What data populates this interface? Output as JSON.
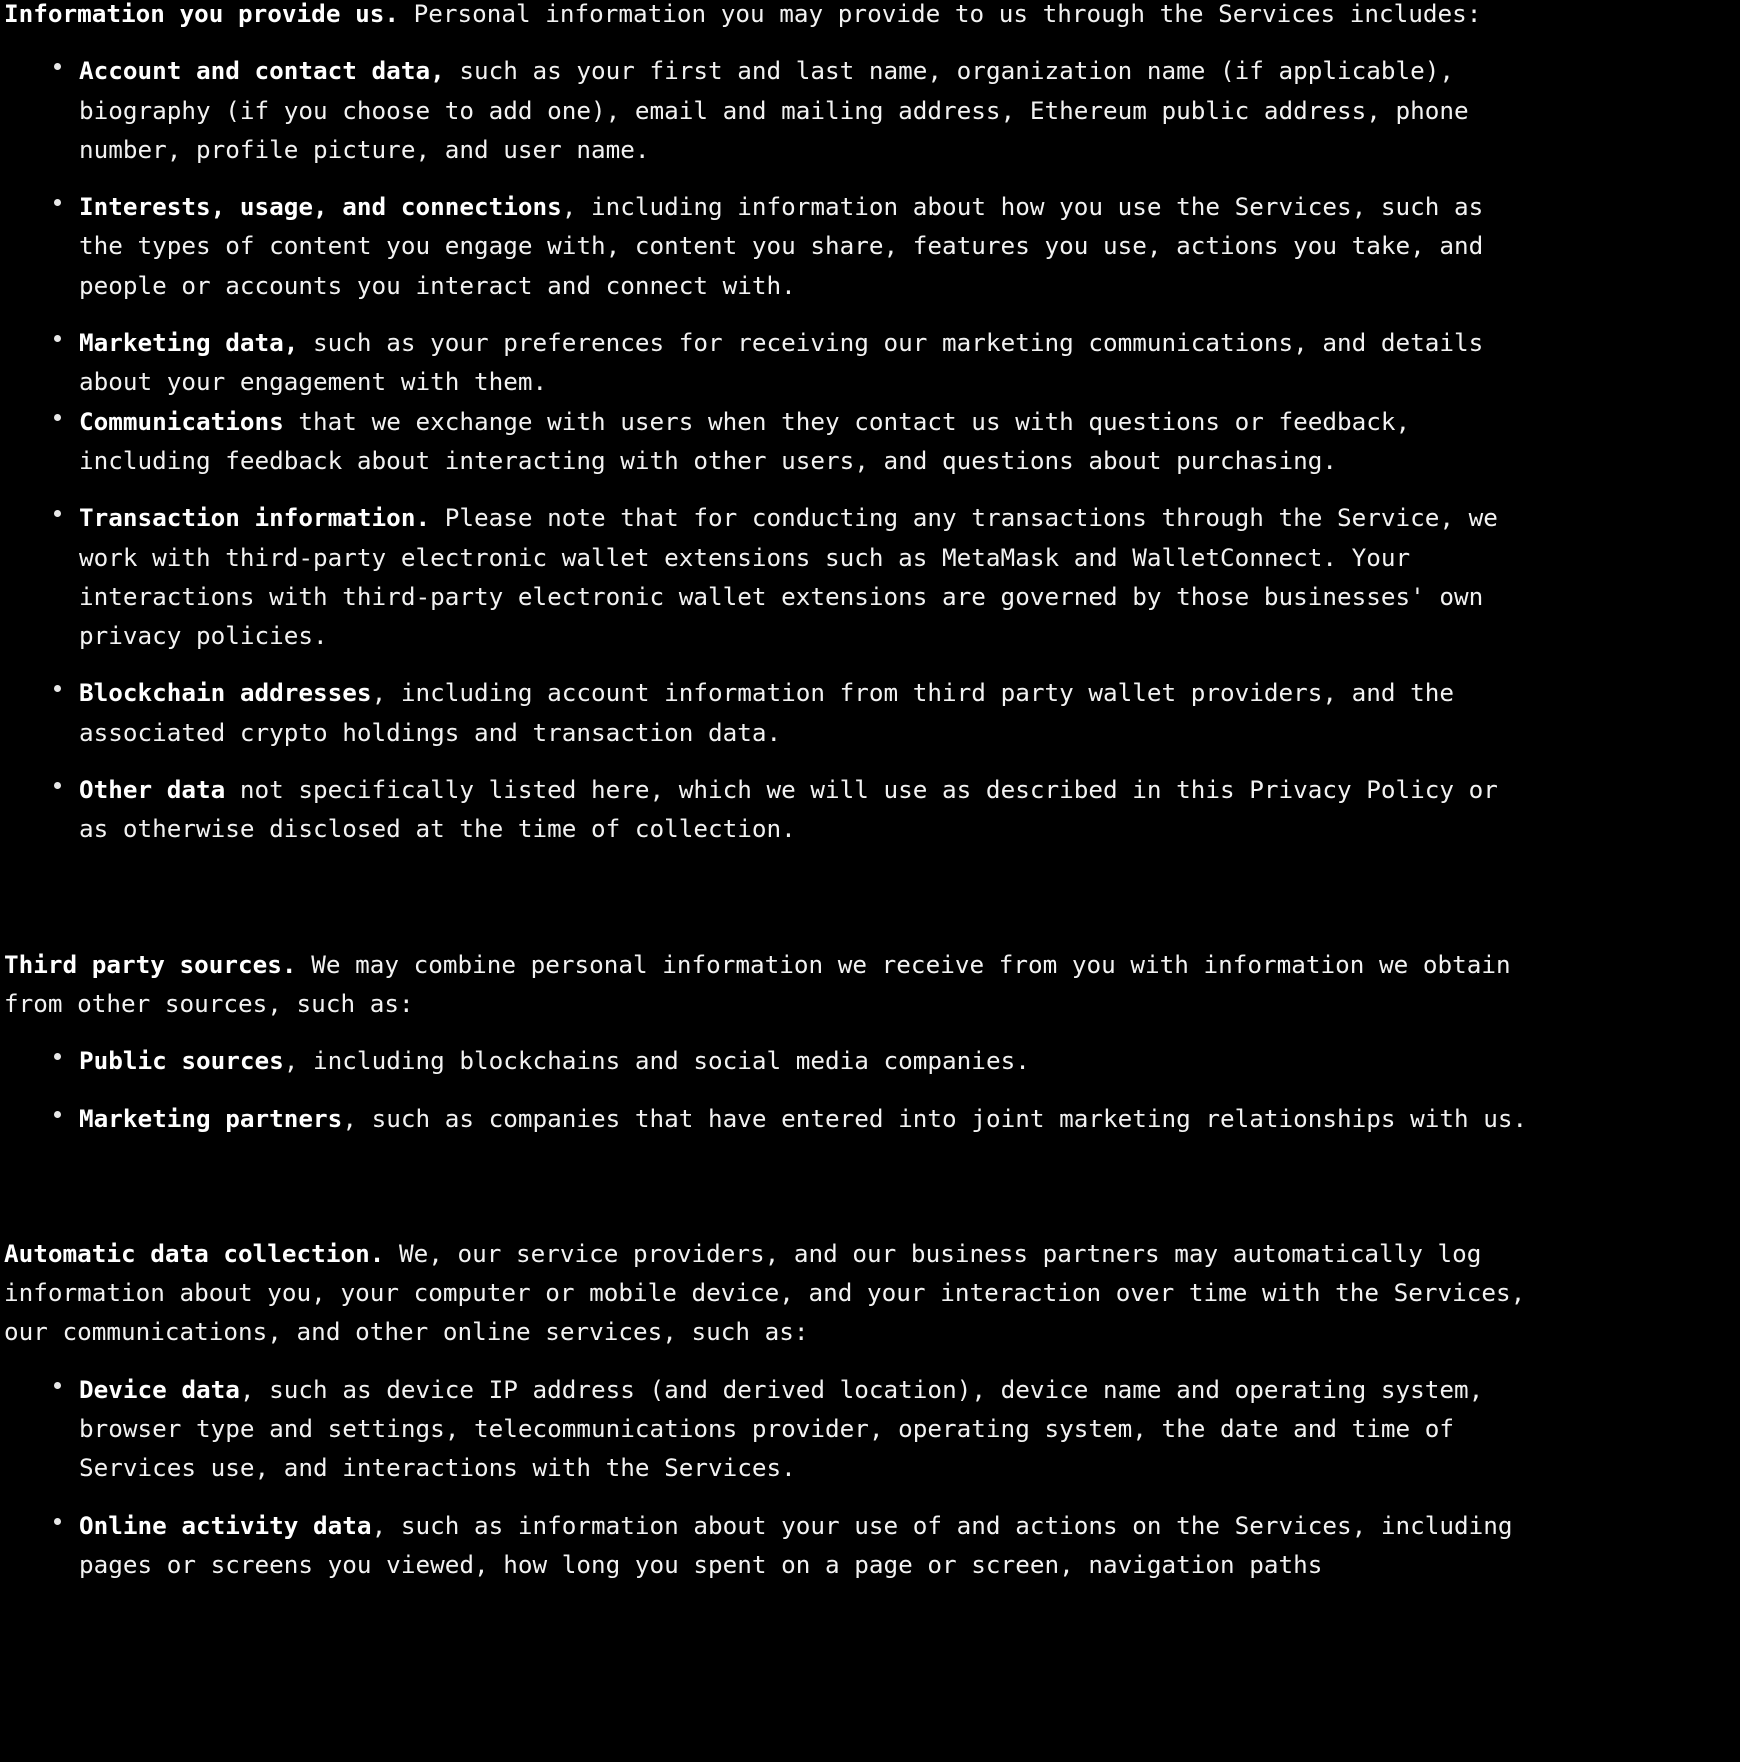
{
  "document": {
    "type": "privacy-policy-body",
    "background_color": "#000000",
    "text_color": "#f2f2f2",
    "heading_color": "#ffffff"
  },
  "sections": [
    {
      "id": "information-you-provide-us",
      "lead_bold": "Information you provide us.",
      "lead_rest": " Personal information you may provide to us through the Services includes:",
      "items": [
        {
          "bold": "Account and contact data,",
          "rest": " such as your first and last name, organization name (if applicable), biography (if you choose to add one), email and mailing address, Ethereum public address, phone number, profile picture, and user name."
        },
        {
          "bold": "Interests, usage, and connections",
          "rest": ", including information about how you use the Services, such as the types of content you engage with, content you share, features you use, actions you take, and people or accounts you interact and connect with."
        },
        {
          "bold": "Marketing data,",
          "rest": " such as your preferences for receiving our marketing communications, and details about your engagement with them."
        },
        {
          "bold": "Communications",
          "rest": " that we exchange with users when they contact us with questions or feedback, including feedback about interacting with other users, and questions about purchasing."
        },
        {
          "bold": "Transaction information.",
          "rest": " Please note that for conducting any transactions through the Service, we work with third-party electronic wallet extensions such as MetaMask and WalletConnect. Your interactions with third-party electronic wallet extensions are governed by those businesses' own privacy policies."
        },
        {
          "bold": "Blockchain addresses",
          "rest": ", including account information from third party wallet providers, and the associated crypto holdings and transaction data."
        },
        {
          "bold": "Other data",
          "rest": " not specifically listed here, which we will use as described in this Privacy Policy or as otherwise disclosed at the time of collection."
        }
      ]
    },
    {
      "id": "third-party-sources",
      "lead_bold": "Third party sources.",
      "lead_rest": " We may combine personal information we receive from you with information we obtain from other sources, such as:",
      "items": [
        {
          "bold": "Public sources",
          "rest": ", including blockchains and social media companies."
        },
        {
          "bold": "Marketing partners",
          "rest": ", such as companies that have entered into joint marketing relationships with us."
        }
      ]
    },
    {
      "id": "automatic-data-collection",
      "lead_bold": "Automatic data collection.",
      "lead_rest": " We, our service providers, and our business partners may automatically log information about you, your computer or mobile device, and your interaction over time with the Services, our communications, and other online services, such as:",
      "items": [
        {
          "bold": "Device data",
          "rest": ", such as device IP address (and derived location), device name and operating system, browser type and settings, telecommunications provider, operating system, the date and time of Services use, and interactions with the Services."
        },
        {
          "bold": "Online activity data",
          "rest": ", such as information about your use of and actions on the Services, including pages or screens you viewed, how long you spent on a page or screen, navigation paths"
        }
      ]
    }
  ]
}
